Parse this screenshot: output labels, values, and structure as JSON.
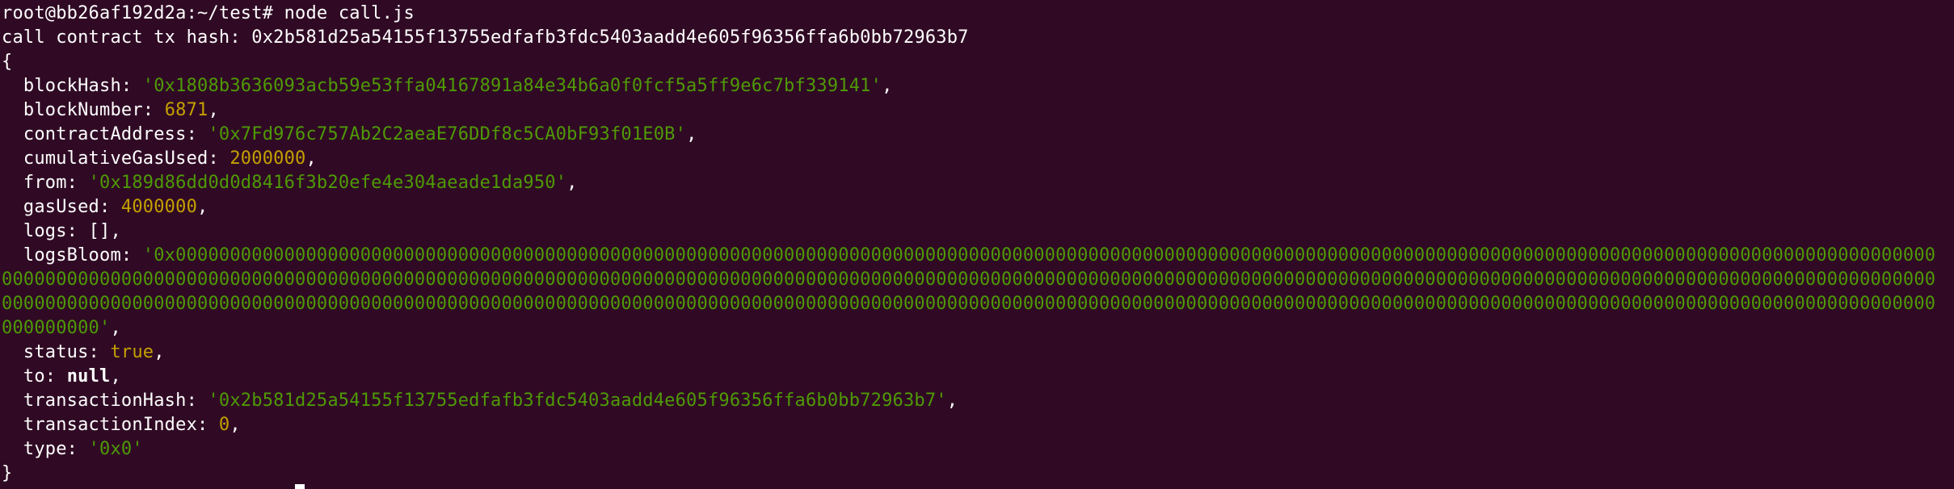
{
  "terminal": {
    "prompt": "root@bb26af192d2a:~/test#",
    "command": "node call.js",
    "tx_hash_label": "call contract tx hash:",
    "tx_hash_value": "0x2b581d25a54155f13755edfafb3fdc5403aadd4e605f96356ffa6b0bb72963b7",
    "open_brace": "{",
    "close_brace": "}",
    "receipt": {
      "blockHash": {
        "key": "blockHash:",
        "value": "'0x1808b3636093acb59e53ffa04167891a84e34b6a0f0fcf5a5ff9e6c7bf339141'"
      },
      "blockNumber": {
        "key": "blockNumber:",
        "value": "6871"
      },
      "contractAddress": {
        "key": "contractAddress:",
        "value": "'0x7Fd976c757Ab2C2aeaE76DDf8c5CA0bF93f01E0B'"
      },
      "cumulativeGasUsed": {
        "key": "cumulativeGasUsed:",
        "value": "2000000"
      },
      "from": {
        "key": "from:",
        "value": "'0x189d86dd0d0d8416f3b20efe4e304aeade1da950'"
      },
      "gasUsed": {
        "key": "gasUsed:",
        "value": "4000000"
      },
      "logs": {
        "key": "logs:",
        "value": "[]"
      },
      "logsBloom": {
        "key": "logsBloom:",
        "value": "'0x00000000000000000000000000000000000000000000000000000000000000000000000000000000000000000000000000000000000000000000000000000000000000000000000000000000000000000000000000000000000000000000000000000000000000000000000000000000000000000000000000000000000000000000000000000000000000000000000000000000000000000000000000000000000000000000000000000000000000000000000000000000000000000000000000000000000000000000000000000000000000000000000000000000000000000000000000000000000000000000000000000000000000000000000000000000000000000000000'"
      },
      "status": {
        "key": "status:",
        "value": "true"
      },
      "to": {
        "key": "to:",
        "value": "null"
      },
      "transactionHash": {
        "key": "transactionHash:",
        "value": "'0x2b581d25a54155f13755edfafb3fdc5403aadd4e605f96356ffa6b0bb72963b7'"
      },
      "transactionIndex": {
        "key": "transactionIndex:",
        "value": "0"
      },
      "type": {
        "key": "type:",
        "value": "'0x0'"
      }
    }
  },
  "colors": {
    "background": "#300a24",
    "text": "#ffffff",
    "string": "#4e9a06",
    "number": "#c4a000"
  }
}
